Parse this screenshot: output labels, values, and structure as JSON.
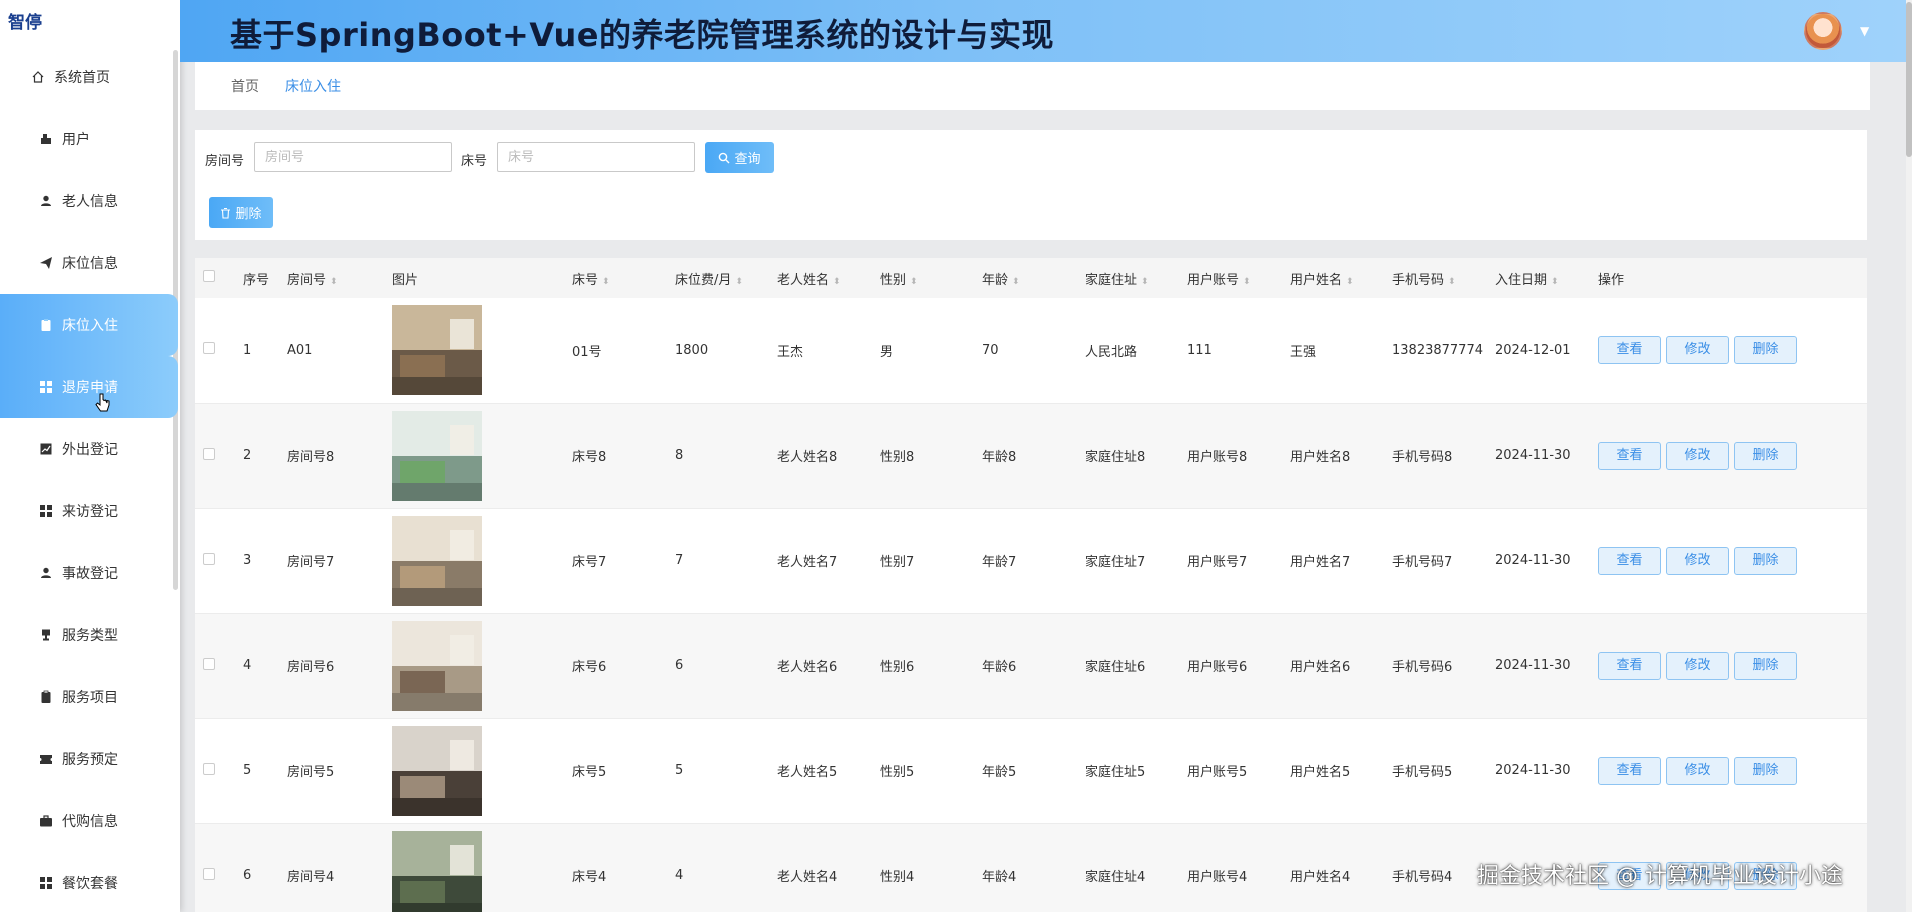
{
  "app": {
    "logo": "智停",
    "title": "基于SpringBoot+Vue的养老院管理系统的设计与实现"
  },
  "sidebar": {
    "items": [
      {
        "label": "系统首页",
        "icon": "home-icon"
      },
      {
        "label": "用户",
        "icon": "user-icon"
      },
      {
        "label": "老人信息",
        "icon": "person-icon"
      },
      {
        "label": "床位信息",
        "icon": "send-icon"
      },
      {
        "label": "床位入住",
        "icon": "clipboard-icon"
      },
      {
        "label": "退房申请",
        "icon": "grid-icon"
      },
      {
        "label": "外出登记",
        "icon": "chart-icon"
      },
      {
        "label": "来访登记",
        "icon": "grid-icon"
      },
      {
        "label": "事故登记",
        "icon": "person-icon"
      },
      {
        "label": "服务类型",
        "icon": "cup-icon"
      },
      {
        "label": "服务项目",
        "icon": "clipboard-icon"
      },
      {
        "label": "服务预定",
        "icon": "ticket-icon"
      },
      {
        "label": "代购信息",
        "icon": "briefcase-icon"
      },
      {
        "label": "餐饮套餐",
        "icon": "grid-icon"
      }
    ]
  },
  "breadcrumb": {
    "home": "首页",
    "current": "床位入住"
  },
  "search": {
    "room_label": "房间号",
    "room_placeholder": "房间号",
    "bed_label": "床号",
    "bed_placeholder": "床号",
    "query_button": "查询",
    "delete_button": "删除"
  },
  "table": {
    "headers": [
      "序号",
      "房间号",
      "图片",
      "床号",
      "床位费/月",
      "老人姓名",
      "性别",
      "年龄",
      "家庭住址",
      "用户账号",
      "用户姓名",
      "手机号码",
      "入住日期",
      "操作"
    ],
    "actions": {
      "view": "查看",
      "edit": "修改",
      "delete": "删除"
    },
    "rows": [
      {
        "index": "1",
        "room": "A01",
        "bed": "01号",
        "fee": "1800",
        "name": "王杰",
        "gender": "男",
        "age": "70",
        "address": "人民北路",
        "account": "111",
        "username": "王强",
        "phone": "13823877774",
        "date": "2024-12-01"
      },
      {
        "index": "2",
        "room": "房间号8",
        "bed": "床号8",
        "fee": "8",
        "name": "老人姓名8",
        "gender": "性别8",
        "age": "年龄8",
        "address": "家庭住址8",
        "account": "用户账号8",
        "username": "用户姓名8",
        "phone": "手机号码8",
        "date": "2024-11-30"
      },
      {
        "index": "3",
        "room": "房间号7",
        "bed": "床号7",
        "fee": "7",
        "name": "老人姓名7",
        "gender": "性别7",
        "age": "年龄7",
        "address": "家庭住址7",
        "account": "用户账号7",
        "username": "用户姓名7",
        "phone": "手机号码7",
        "date": "2024-11-30"
      },
      {
        "index": "4",
        "room": "房间号6",
        "bed": "床号6",
        "fee": "6",
        "name": "老人姓名6",
        "gender": "性别6",
        "age": "年龄6",
        "address": "家庭住址6",
        "account": "用户账号6",
        "username": "用户姓名6",
        "phone": "手机号码6",
        "date": "2024-11-30"
      },
      {
        "index": "5",
        "room": "房间号5",
        "bed": "床号5",
        "fee": "5",
        "name": "老人姓名5",
        "gender": "性别5",
        "age": "年龄5",
        "address": "家庭住址5",
        "account": "用户账号5",
        "username": "用户姓名5",
        "phone": "手机号码5",
        "date": "2024-11-30"
      },
      {
        "index": "6",
        "room": "房间号4",
        "bed": "床号4",
        "fee": "4",
        "name": "老人姓名4",
        "gender": "性别4",
        "age": "年龄4",
        "address": "家庭住址4",
        "account": "用户账号4",
        "username": "用户姓名4",
        "phone": "手机号码4",
        "date": ""
      }
    ]
  },
  "watermark": "掘金技术社区 @ 计算机毕业设计小途",
  "colors": {
    "accent": "#4aa8f5",
    "header_start": "#4fa6f3",
    "header_end": "#9fd2fb"
  }
}
